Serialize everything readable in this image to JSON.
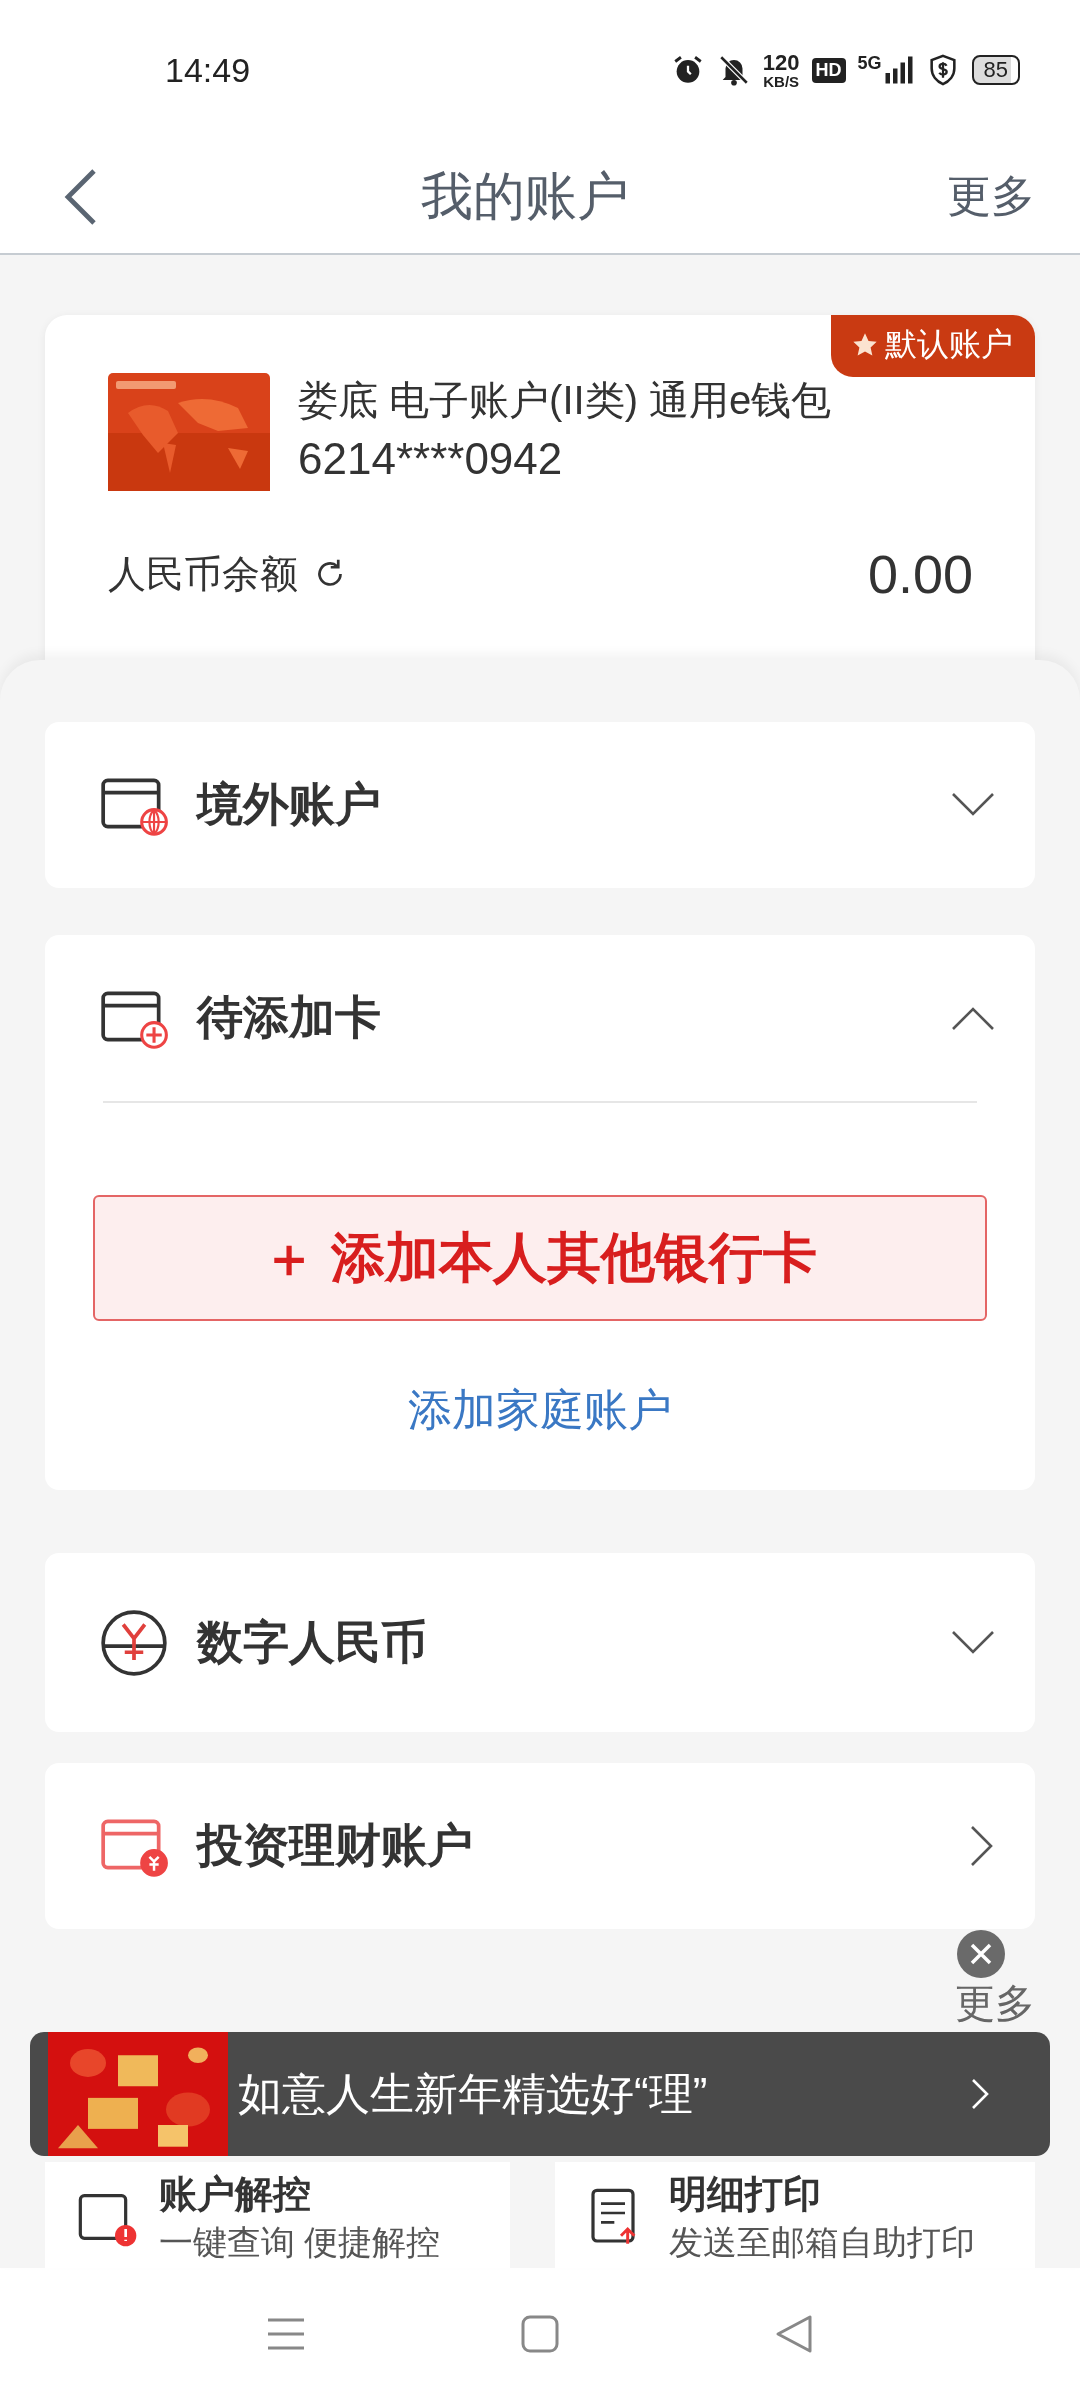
{
  "status_bar": {
    "time": "14:49",
    "speed": "120",
    "speed_unit": "KB/S",
    "hd": "HD",
    "network": "5G",
    "battery": "85"
  },
  "header": {
    "title": "我的账户",
    "more": "更多"
  },
  "account_card": {
    "badge": "默认账户",
    "name": "娄底 电子账户(II类) 通用e钱包",
    "number": "6214****0942",
    "balance_label": "人民币余额",
    "balance": "0.00"
  },
  "sections": [
    {
      "kind": "collapsible",
      "label": "境外账户",
      "expanded": false
    },
    {
      "kind": "collapsible",
      "label": "待添加卡",
      "expanded": true,
      "add_button": "＋ 添加本人其他银行卡",
      "family_link": "添加家庭账户"
    },
    {
      "kind": "collapsible",
      "label": "数字人民币",
      "expanded": false
    },
    {
      "kind": "link",
      "label": "投资理财账户"
    }
  ],
  "services": {
    "more": "更多",
    "tiles": [
      {
        "title": "账户解控",
        "subtitle": "一键查询 便捷解控"
      },
      {
        "title": "明细打印",
        "subtitle": "发送至邮箱自助打印"
      }
    ]
  },
  "banner": {
    "text": "如意人生新年精选好“理”"
  }
}
